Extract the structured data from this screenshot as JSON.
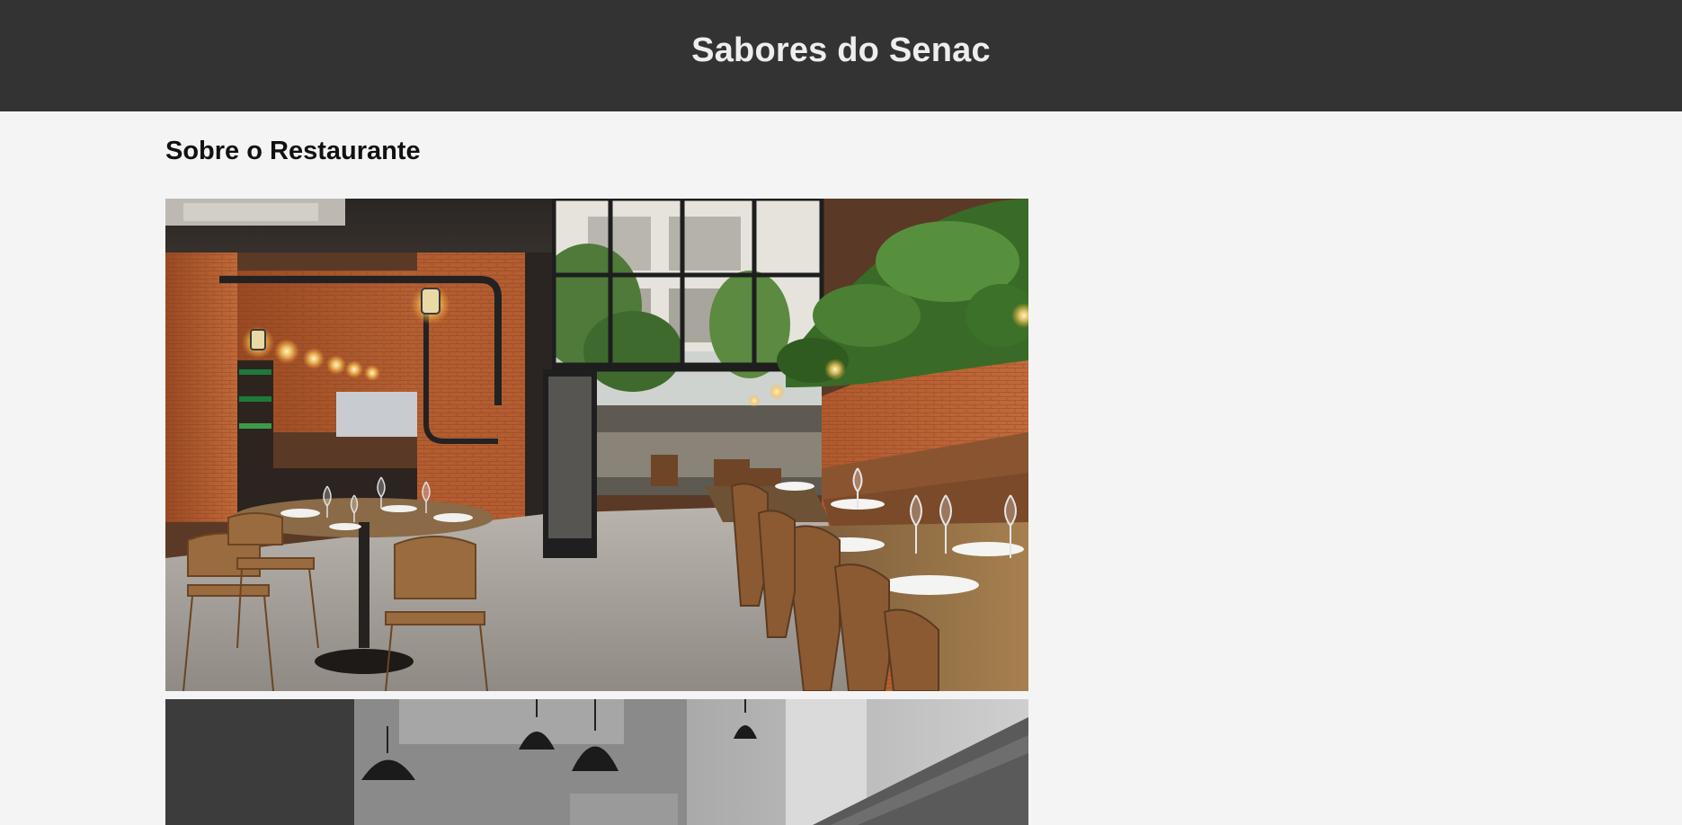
{
  "header": {
    "title": "Sabores do Senac",
    "background": "#333333",
    "title_color": "#eeeeee"
  },
  "about": {
    "heading": "Sobre o Restaurante",
    "images": [
      {
        "subject": "restaurant-interior-brick-wall-photo"
      },
      {
        "subject": "restaurant-interior-pendant-lamps-photo"
      }
    ]
  },
  "page": {
    "background": "#f4f4f4"
  }
}
